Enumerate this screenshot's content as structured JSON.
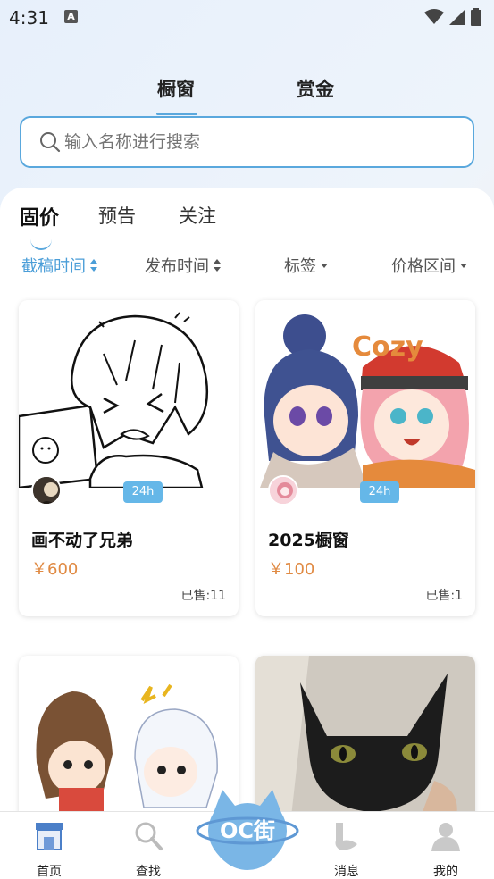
{
  "status": {
    "time": "4:31",
    "notif_icon": "A"
  },
  "top_tabs": [
    {
      "label": "橱窗",
      "active": true
    },
    {
      "label": "赏金",
      "active": false
    }
  ],
  "search": {
    "placeholder": "输入名称进行搜索"
  },
  "sub_tabs": [
    {
      "label": "固价",
      "active": true
    },
    {
      "label": "预告",
      "active": false
    },
    {
      "label": "关注",
      "active": false
    }
  ],
  "filters": [
    {
      "label": "截稿时间",
      "icon": "sort-icon",
      "active": true
    },
    {
      "label": "发布时间",
      "icon": "sort-icon",
      "active": false
    },
    {
      "label": "标签",
      "icon": "caret-down-icon",
      "active": false
    },
    {
      "label": "价格区间",
      "icon": "caret-down-icon",
      "active": false
    }
  ],
  "cards": [
    {
      "title": "画不动了兄弟",
      "price": "￥600",
      "sold": "已售:11",
      "badge": "24h"
    },
    {
      "title": "2025橱窗",
      "price": "￥100",
      "sold": "已售:1",
      "badge": "24h",
      "image_text": "Cozy"
    },
    {
      "title": "",
      "price": "",
      "sold": ""
    },
    {
      "title": "",
      "price": "",
      "sold": ""
    }
  ],
  "bottom_nav": [
    {
      "label": "首页",
      "icon": "shop-icon"
    },
    {
      "label": "查找",
      "icon": "magnifier-icon"
    },
    {
      "label": "消息",
      "icon": "bubble-icon"
    },
    {
      "label": "我的",
      "icon": "profile-icon"
    }
  ],
  "center_logo": {
    "text": "OC街"
  },
  "colors": {
    "accent": "#5aa8dd",
    "price": "#e08a43",
    "badge": "#65b7e8"
  }
}
